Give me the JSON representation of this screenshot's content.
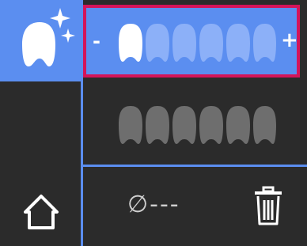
{
  "shade_selector": {
    "minus_label": "-",
    "plus_label": "+"
  },
  "actions": {
    "empty_label": "∅---"
  },
  "colors": {
    "accent": "#5b8ef0",
    "selection_border": "#d4145a",
    "panel_bg": "#2b2b2b"
  },
  "icons": {
    "whiten": "tooth-sparkle-icon",
    "home": "home-icon",
    "trash": "trash-icon"
  }
}
